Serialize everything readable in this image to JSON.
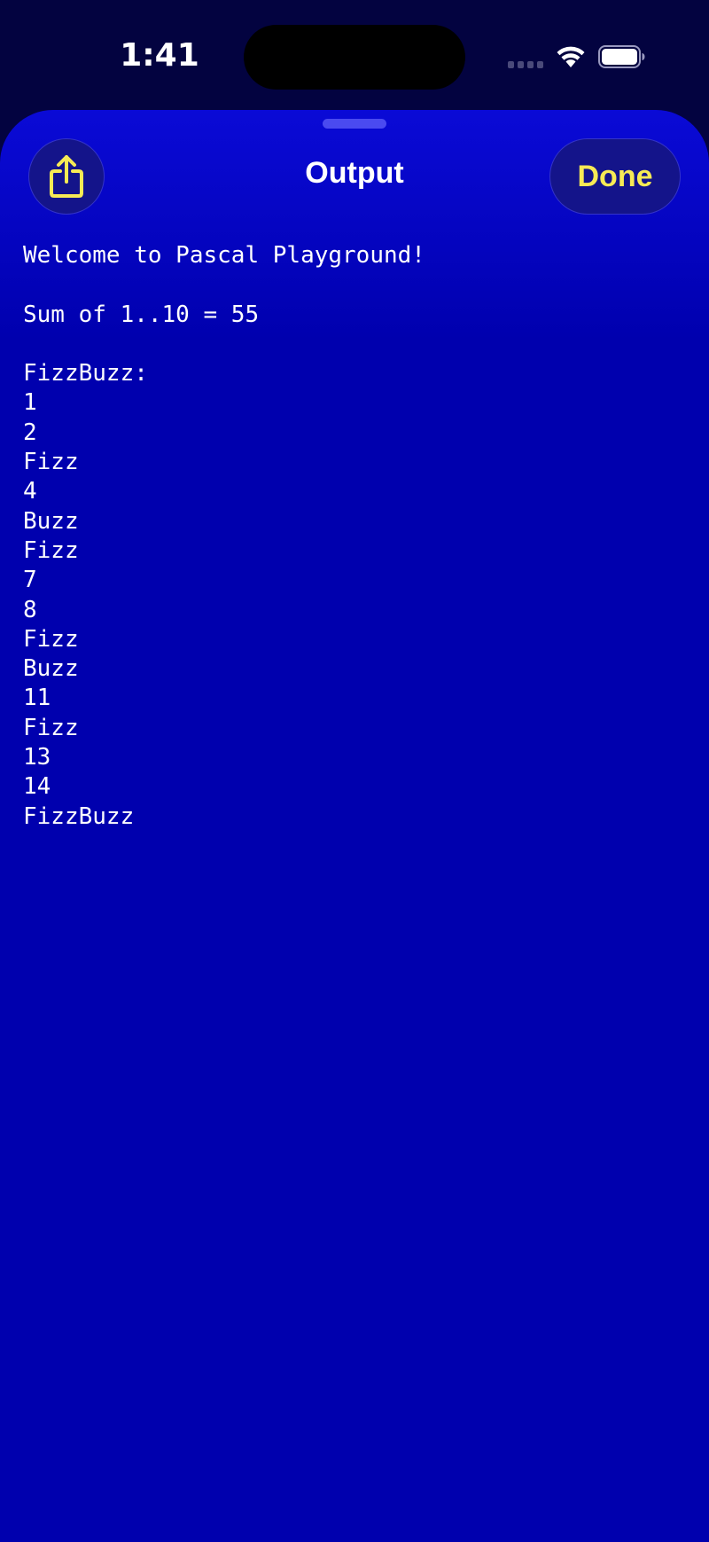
{
  "status_bar": {
    "time": "1:41"
  },
  "sheet": {
    "title": "Output",
    "done_label": "Done",
    "share_icon": "share-icon"
  },
  "colors": {
    "background": "#030340",
    "sheet": "#0000ae",
    "accent": "#f7ea55",
    "text": "#ffffff"
  },
  "output_lines": [
    "Welcome to Pascal Playground!",
    "",
    "Sum of 1..10 = 55",
    "",
    "FizzBuzz:",
    "1",
    "2",
    "Fizz",
    "4",
    "Buzz",
    "Fizz",
    "7",
    "8",
    "Fizz",
    "Buzz",
    "11",
    "Fizz",
    "13",
    "14",
    "FizzBuzz"
  ]
}
